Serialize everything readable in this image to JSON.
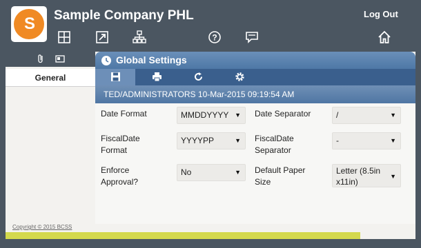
{
  "header": {
    "company_name": "Sample Company PHL",
    "logout_label": "Log Out",
    "logo_letters": "S",
    "icons": [
      "grid-icon",
      "launch-icon",
      "org-chart-icon",
      "help-icon",
      "chat-icon",
      "home-icon"
    ]
  },
  "left": {
    "icons": [
      "attachment-icon",
      "card-icon"
    ],
    "tab_label": "General"
  },
  "main": {
    "title": "Global Settings",
    "toolbar": [
      "save-icon",
      "print-icon",
      "refresh-icon",
      "settings-icon"
    ],
    "user_info": "TED/ADMINISTRATORS 10-Mar-2015 09:19:54 AM"
  },
  "form": {
    "date_format_label": "Date Format",
    "date_format_value": "MMDDYYYY",
    "date_separator_label": "Date Separator",
    "date_separator_value": "/",
    "fiscal_format_label_1": "FiscalDate",
    "fiscal_format_label_2": "Format",
    "fiscal_format_value": "YYYYPP",
    "fiscal_separator_label_1": "FiscalDate",
    "fiscal_separator_label_2": "Separator",
    "fiscal_separator_value": "-",
    "enforce_label_1": "Enforce",
    "enforce_label_2": "Approval?",
    "enforce_value": "No",
    "paper_label_1": "Default Paper",
    "paper_label_2": "Size",
    "paper_value_1": "Letter (8.5in",
    "paper_value_2": "x11in)"
  },
  "footer": {
    "copyright": "Copyright © 2015 BCSS"
  },
  "colors": {
    "header_bg": "#4b5661",
    "title_blue": "#4e78a6",
    "toolbar_blue": "#3a5f8d",
    "logo_orange": "#f08a24",
    "yellow_bar": "#d4d94d"
  }
}
